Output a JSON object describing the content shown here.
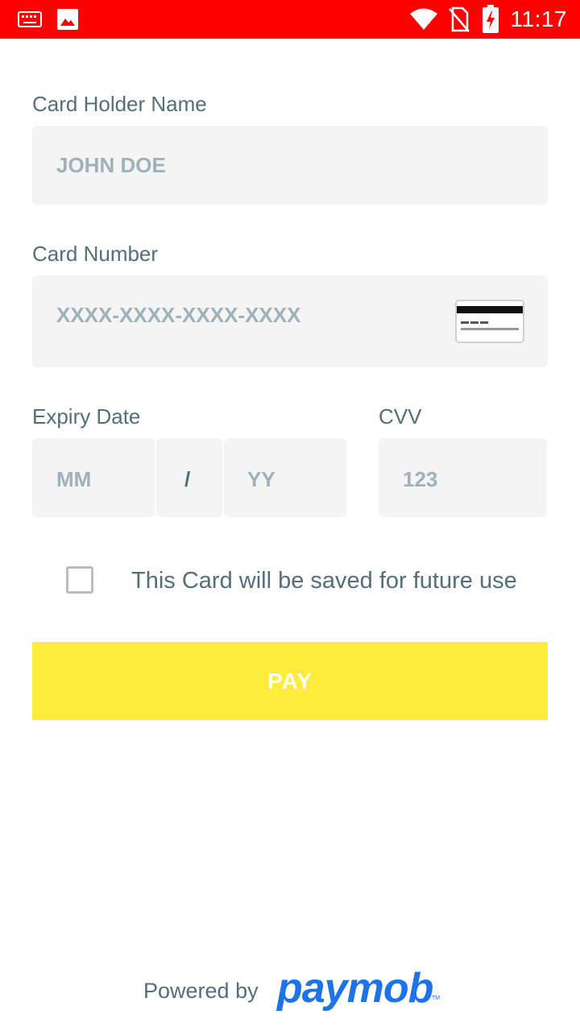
{
  "status_bar": {
    "time": "11:17",
    "icons": [
      "keyboard-icon",
      "image-icon",
      "wifi-icon",
      "no-sim-icon",
      "battery-charging-icon"
    ],
    "color": "#ff0000"
  },
  "form": {
    "holder_name": {
      "label": "Card Holder Name",
      "placeholder": "JOHN DOE",
      "value": ""
    },
    "card_number": {
      "label": "Card Number",
      "placeholder": "XXXX-XXXX-XXXX-XXXX",
      "value": "",
      "icon": "credit-card-icon"
    },
    "expiry": {
      "label": "Expiry Date",
      "month_placeholder": "MM",
      "separator": "/",
      "year_placeholder": "YY"
    },
    "cvv": {
      "label": "CVV",
      "placeholder": "123"
    },
    "save_card": {
      "label": "This Card will be saved for future use",
      "checked": false
    },
    "pay_button": {
      "label": "PAY",
      "color": "#ffeb3b"
    }
  },
  "footer": {
    "powered_by": "Powered by",
    "brand": "paymob",
    "brand_tm": "TM",
    "brand_color": "#1e73e8"
  }
}
